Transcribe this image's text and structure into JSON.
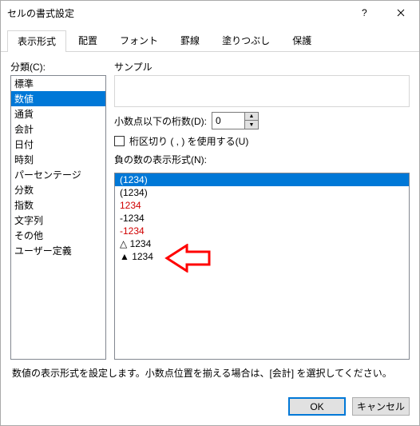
{
  "window": {
    "title": "セルの書式設定"
  },
  "tabs": [
    "表示形式",
    "配置",
    "フォント",
    "罫線",
    "塗りつぶし",
    "保護"
  ],
  "active_tab": 0,
  "category": {
    "label": "分類(C):",
    "items": [
      "標準",
      "数値",
      "通貨",
      "会計",
      "日付",
      "時刻",
      "パーセンテージ",
      "分数",
      "指数",
      "文字列",
      "その他",
      "ユーザー定義"
    ],
    "selected": 1
  },
  "sample": {
    "label": "サンプル",
    "value": ""
  },
  "decimal": {
    "label": "小数点以下の桁数(D):",
    "value": "0"
  },
  "thousand_sep": {
    "label": "桁区切り ( , ) を使用する(U)",
    "checked": false
  },
  "negative": {
    "label": "負の数の表示形式(N):",
    "items": [
      {
        "text": "(1234)",
        "color": "red"
      },
      {
        "text": "(1234)",
        "color": "black"
      },
      {
        "text": "1234",
        "color": "red"
      },
      {
        "text": "-1234",
        "color": "black"
      },
      {
        "text": "-1234",
        "color": "red"
      },
      {
        "text": "△ 1234",
        "color": "black"
      },
      {
        "text": "▲ 1234",
        "color": "black"
      }
    ],
    "selected": 0
  },
  "description": "数値の表示形式を設定します。小数点位置を揃える場合は、[会計] を選択してください。",
  "buttons": {
    "ok": "OK",
    "cancel": "キャンセル"
  }
}
